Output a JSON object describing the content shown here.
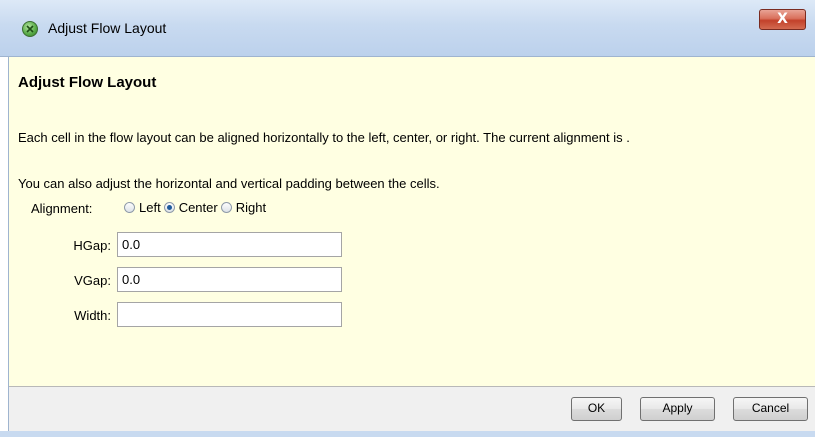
{
  "window": {
    "title": "Adjust Flow Layout",
    "close_label": "X"
  },
  "content": {
    "heading": "Adjust Flow Layout",
    "paragraph1": "Each cell in the flow layout can be aligned horizontally to the left, center, or right. The current alignment is .",
    "paragraph2": "You can also adjust the horizontal and vertical padding between the cells.",
    "alignment": {
      "label": "Alignment:",
      "options": [
        "Left",
        "Center",
        "Right"
      ],
      "selected": "Center"
    },
    "fields": {
      "hgap": {
        "label": "HGap:",
        "value": "0.0"
      },
      "vgap": {
        "label": "VGap:",
        "value": "0.0"
      },
      "width": {
        "label": "Width:",
        "value": ""
      }
    }
  },
  "buttons": {
    "ok": "OK",
    "apply": "Apply",
    "cancel": "Cancel"
  },
  "colors": {
    "content_background": "#ffffe2",
    "titlebar": "#c8daf0",
    "close_button": "#c2412a"
  }
}
